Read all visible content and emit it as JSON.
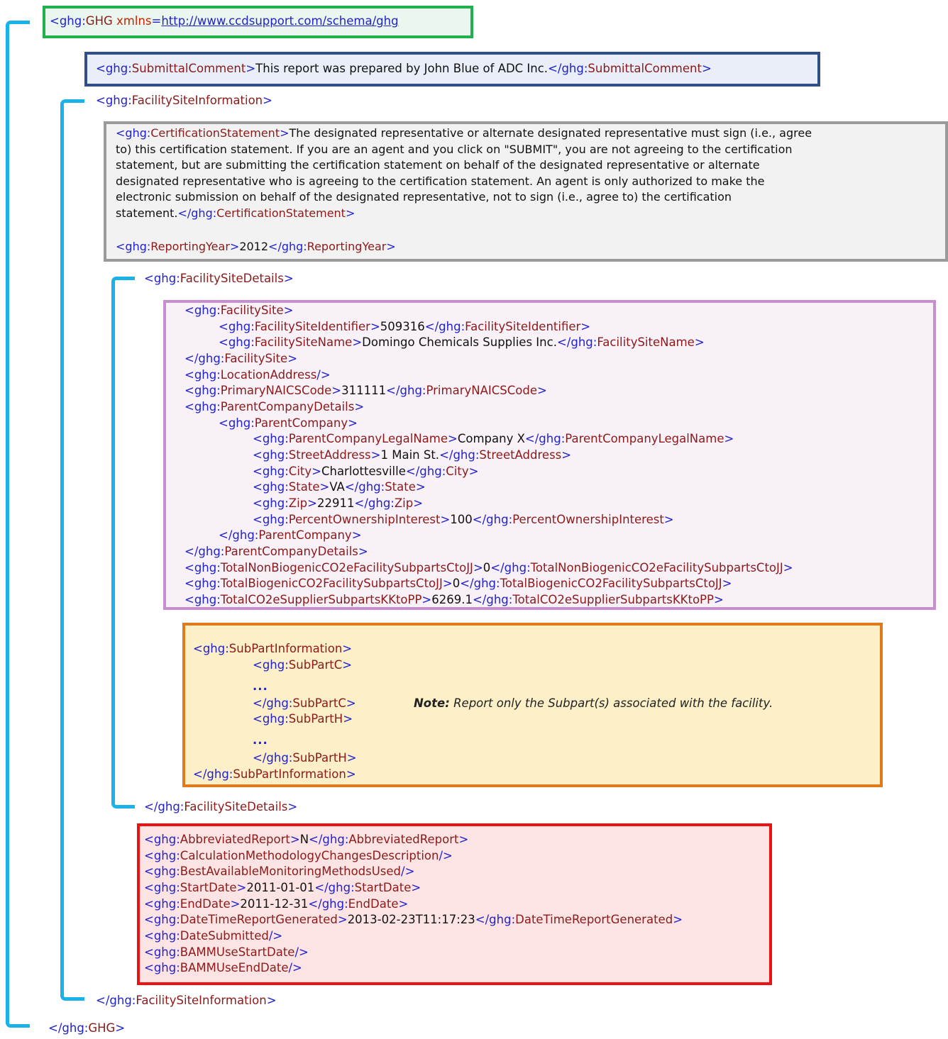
{
  "prefix": "ghg",
  "root": {
    "name": "GHG",
    "attr_name": "xmlns",
    "attr_value": "http://www.ccdsupport.com/schema/ghg"
  },
  "submittal_comment": {
    "name": "SubmittalComment",
    "text": "This report was prepared by John Blue of ADC Inc."
  },
  "facility_site_information": {
    "name": "FacilitySiteInformation"
  },
  "certification": {
    "name": "CertificationStatement",
    "text_lines": [
      "The designated representative or alternate designated representative must sign (i.e., agree",
      "to) this certification statement. If you are an agent and you click on  \"SUBMIT\", you are not agreeing to the certification",
      "statement, but are submitting the certification statement on behalf of the designated  representative or alternate",
      "designated representative who is agreeing to the certification statement. An agent is only authorized to make the",
      "electronic submission on behalf of the designated representative, not to sign (i.e., agree to) the certification",
      "statement."
    ]
  },
  "reporting_year": {
    "name": "ReportingYear",
    "value": "2012"
  },
  "facility_site_details": {
    "name": "FacilitySiteDetails"
  },
  "facility_site": {
    "name": "FacilitySite",
    "identifier": {
      "name": "FacilitySiteIdentifier",
      "value": "509316"
    },
    "site_name": {
      "name": "FacilitySiteName",
      "value": "Domingo Chemicals Supplies Inc."
    }
  },
  "location_address": {
    "name": "LocationAddress"
  },
  "naics": {
    "name": "PrimaryNAICSCode",
    "value": "311111"
  },
  "parent_company_details": {
    "name": "ParentCompanyDetails"
  },
  "parent_company": {
    "name": "ParentCompany",
    "legal_name": {
      "name": "ParentCompanyLegalName",
      "value": "Company X"
    },
    "street": {
      "name": "StreetAddress",
      "value": "1 Main St."
    },
    "city": {
      "name": "City",
      "value": "Charlottesville"
    },
    "state": {
      "name": "State",
      "value": "VA"
    },
    "zip": {
      "name": "Zip",
      "value": "22911"
    },
    "ownership": {
      "name": "PercentOwnershipInterest",
      "value": "100"
    }
  },
  "totals": [
    {
      "name": "TotalNonBiogenicCO2eFacilitySubpartsCtoJJ",
      "value": "0"
    },
    {
      "name": "TotalBiogenicCO2FacilitySubpartsCtoJJ",
      "value": "0"
    },
    {
      "name": "TotalCO2eSupplierSubpartsKKtoPP",
      "value": "6269.1"
    }
  ],
  "subpart_info": {
    "name": "SubPartInformation",
    "subpart_c": "SubPartC",
    "subpart_h": "SubPartH",
    "ellipsis": "...",
    "note_label": "Note:",
    "note_text": " Report only the Subpart(s) associated with the facility."
  },
  "report": {
    "abbreviated": {
      "name": "AbbreviatedReport",
      "value": "N"
    },
    "calc_changes": {
      "name": "CalculationMethodologyChangesDescription"
    },
    "best_available": {
      "name": "BestAvailableMonitoringMethodsUsed"
    },
    "start_date": {
      "name": "StartDate",
      "value": "2011-01-01"
    },
    "end_date": {
      "name": "EndDate",
      "value": "2011-12-31"
    },
    "generated": {
      "name": "DateTimeReportGenerated",
      "value": "2013-02-23T11:17:23"
    },
    "date_submitted": {
      "name": "DateSubmitted"
    },
    "bamm_start": {
      "name": "BAMMUseStartDate"
    },
    "bamm_end": {
      "name": "BAMMUseEndDate"
    }
  },
  "colors": {
    "bracket": "#1ab2e8",
    "root_box": "#22b04c",
    "comment_box": "#2f4f8a",
    "cert_box": "#9a9a9a",
    "site_box": "#c88fcf",
    "subpart_box": "#e07a1a",
    "report_box": "#ee1111"
  }
}
